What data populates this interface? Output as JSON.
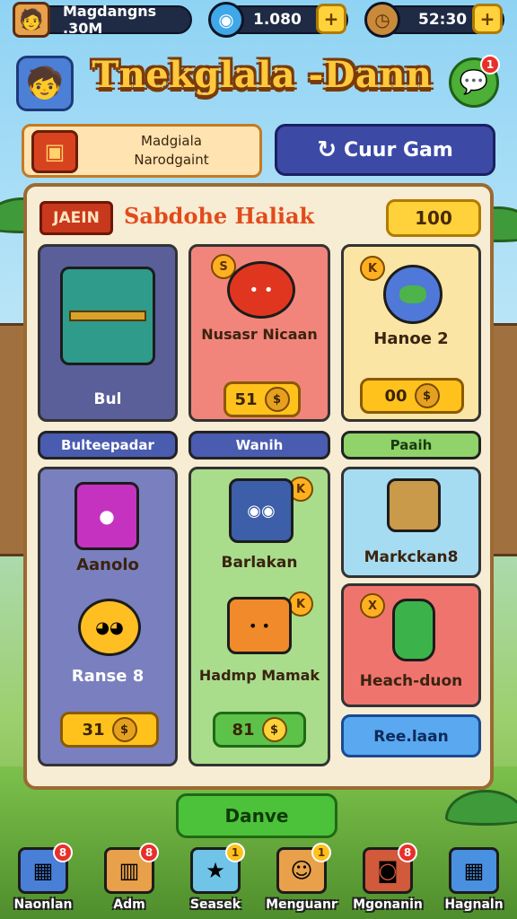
{
  "topbar": {
    "player_name": "Magdangns .30M",
    "gems": "1.080",
    "timer": "52:30",
    "add_symbol": "+"
  },
  "header": {
    "title": "Tnekglala -Dann",
    "chat_badge": "1"
  },
  "actions": {
    "bag_label_line1": "Madgiala",
    "bag_label_line2": "Narodgaint",
    "currency_button": "Cuur Gam"
  },
  "panel": {
    "tag": "JAEIN",
    "title": "Sabdohe Haliak",
    "points": "100",
    "cards": [
      {
        "name": "Bul"
      },
      {
        "name": "Nusasr Nicaan",
        "price": "51",
        "coin": "S"
      },
      {
        "name": "Hanoe 2",
        "price": "00",
        "coin": "K"
      }
    ],
    "categories": [
      "Bulteepadar",
      "Wanih",
      "Paaih"
    ],
    "cards2": [
      {
        "name": "Aanolo"
      },
      {
        "name": "Ranse 8",
        "price": "31"
      },
      {
        "name": "Barlakan",
        "coin": "K"
      },
      {
        "name": "Hadmp Mamak",
        "price": "81",
        "coin": "K"
      },
      {
        "name": "Markckan8"
      },
      {
        "name": "Heach-duon",
        "coin": "X"
      },
      {
        "name": "Ree.laan"
      }
    ]
  },
  "claim_button": "Danve",
  "nav": [
    {
      "label": "Naonlan",
      "badge": "8"
    },
    {
      "label": "Adm",
      "badge": "8"
    },
    {
      "label": "Seasek",
      "badge": "1"
    },
    {
      "label": "Menguanr",
      "badge": "1"
    },
    {
      "label": "Mgonanin",
      "badge": "8"
    },
    {
      "label": "Hagnaln",
      "badge": ""
    }
  ],
  "colors": {
    "panel_bg": "#f7ecd4",
    "accent_gold": "#ffd23c",
    "title_orange": "#ffc93c",
    "tab_red": "#c8381d"
  }
}
